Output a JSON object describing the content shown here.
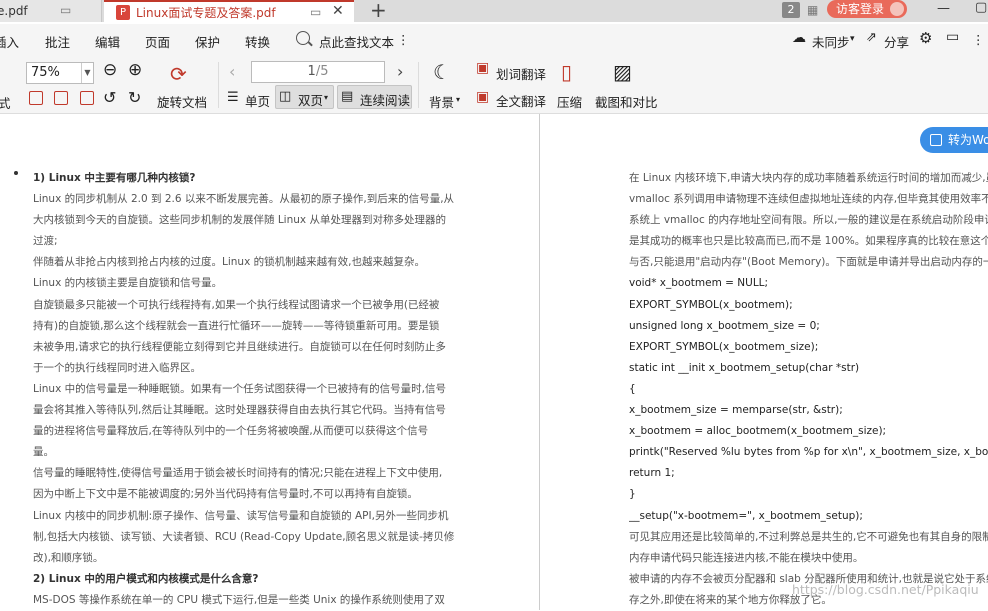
{
  "tabs": [
    {
      "title": "e.pdf"
    },
    {
      "title": "Linux面试专题及答案.pdf"
    }
  ],
  "tab_count": "2",
  "login_label": "访客登录",
  "menu": [
    "插入",
    "批注",
    "编辑",
    "页面",
    "保护",
    "转换"
  ],
  "search_label": "点此查找文本",
  "right_menu": {
    "sync": "未同步",
    "share": "分享"
  },
  "toolbar": {
    "left_partial": "式",
    "zoom": "75%",
    "rotate": "旋转文档",
    "page_current": "1",
    "page_total": "/5",
    "single": "单页",
    "double": "双页",
    "continuous": "连续阅读",
    "background": "背景",
    "word_translate": "划词翻译",
    "full_translate": "全文翻译",
    "compress": "压缩",
    "screenshot": "截图和对比"
  },
  "convert_label": "转为Wo",
  "left_page": [
    {
      "t": "1) Linux 中主要有哪几种内核锁?",
      "h": true
    },
    {
      "t": "Linux 的同步机制从 2.0 到 2.6 以来不断发展完善。从最初的原子操作,到后来的信号量,从"
    },
    {
      "t": "大内核锁到今天的自旋锁。这些同步机制的发展伴随 Linux 从单处理器到对称多处理器的"
    },
    {
      "t": "过渡;"
    },
    {
      "t": "伴随着从非抢占内核到抢占内核的过度。Linux 的锁机制越来越有效,也越来越复杂。"
    },
    {
      "t": "Linux 的内核锁主要是自旋锁和信号量。"
    },
    {
      "t": "自旋锁最多只能被一个可执行线程持有,如果一个执行线程试图请求一个已被争用(已经被"
    },
    {
      "t": "持有)的自旋锁,那么这个线程就会一直进行忙循环——旋转——等待锁重新可用。要是锁"
    },
    {
      "t": "未被争用,请求它的执行线程便能立刻得到它并且继续进行。自旋锁可以在任何时刻防止多"
    },
    {
      "t": "于一个的执行线程同时进入临界区。"
    },
    {
      "t": "Linux 中的信号量是一种睡眠锁。如果有一个任务试图获得一个已被持有的信号量时,信号"
    },
    {
      "t": "量会将其推入等待队列,然后让其睡眠。这时处理器获得自由去执行其它代码。当持有信号"
    },
    {
      "t": "量的进程将信号量释放后,在等待队列中的一个任务将被唤醒,从而便可以获得这个信号"
    },
    {
      "t": "量。"
    },
    {
      "t": "信号量的睡眠特性,使得信号量适用于锁会被长时间持有的情况;只能在进程上下文中使用,"
    },
    {
      "t": "因为中断上下文中是不能被调度的;另外当代码持有信号量时,不可以再持有自旋锁。"
    },
    {
      "t": "Linux 内核中的同步机制:原子操作、信号量、读写信号量和自旋锁的 API,另外一些同步机"
    },
    {
      "t": "制,包括大内核锁、读写锁、大读者锁、RCU (Read-Copy Update,顾名思义就是读-拷贝修"
    },
    {
      "t": "改),和顺序锁。"
    },
    {
      "t": "2) Linux 中的用户模式和内核模式是什么含意?",
      "h": true
    },
    {
      "t": "MS-DOS 等操作系统在单一的 CPU 模式下运行,但是一些类 Unix 的操作系统则使用了双"
    }
  ],
  "right_page": [
    {
      "t": "在 Linux 内核环境下,申请大块内存的成功率随着系统运行时间的增加而减少,虽",
      "g": true
    },
    {
      "t": "vmalloc 系列调用申请物理不连续但虚拟地址连续的内存,但毕竟其使用效率不高",
      "g": true
    },
    {
      "t": "系统上 vmalloc 的内存地址空间有限。所以,一般的建议是在系统启动阶段申请",
      "g": true
    },
    {
      "t": "是其成功的概率也只是比较高而已,而不是 100%。如果程序真的比较在意这个",
      "g": true
    },
    {
      "t": "与否,只能退用\"启动内存\"(Boot Memory)。下面就是申请并导出启动内存的一段",
      "g": true
    },
    {
      "t": "void* x_bootmem = NULL;"
    },
    {
      "t": "EXPORT_SYMBOL(x_bootmem);"
    },
    {
      "t": "unsigned long x_bootmem_size = 0;"
    },
    {
      "t": "EXPORT_SYMBOL(x_bootmem_size);"
    },
    {
      "t": "static int __init x_bootmem_setup(char *str)"
    },
    {
      "t": "{"
    },
    {
      "t": "x_bootmem_size = memparse(str, &str);"
    },
    {
      "t": "x_bootmem = alloc_bootmem(x_bootmem_size);"
    },
    {
      "t": "printk(\"Reserved %lu bytes from %p for x\\n\", x_bootmem_size, x_bootmem);"
    },
    {
      "t": "return 1;"
    },
    {
      "t": "}"
    },
    {
      "t": "__setup(\"x-bootmem=\", x_bootmem_setup);"
    },
    {
      "t": "可见其应用还是比较简单的,不过利弊总是共生的,它不可避免也有其自身的限制",
      "g": true
    },
    {
      "t": "内存申请代码只能连接进内核,不能在模块中使用。",
      "g": true
    },
    {
      "t": "被申请的内存不会被页分配器和 slab 分配器所使用和统计,也就是说它处于系统",
      "g": true
    },
    {
      "t": "存之外,即使在将来的某个地方你释放了它。",
      "g": true
    }
  ],
  "watermark": "https://blog.csdn.net/Ppikaqiu"
}
